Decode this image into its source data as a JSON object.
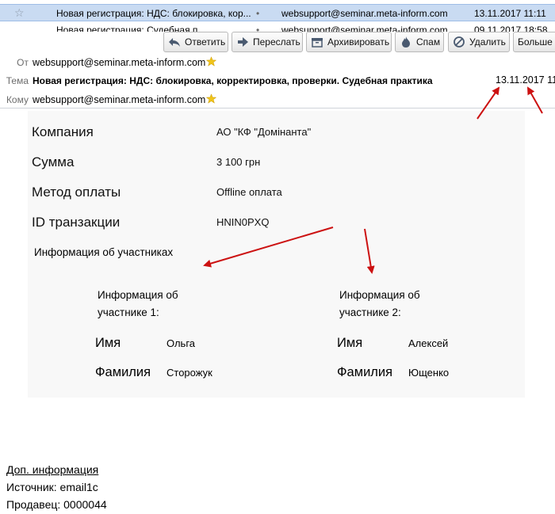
{
  "message_list": {
    "selected": {
      "subject": "Новая регистрация: НДС: блокировка, кор...",
      "from": "websupport@seminar.meta-inform.com",
      "date": "13.11.2017 11:11"
    },
    "next": {
      "subject": "Новая регистрация: Судебная п...",
      "from": "websupport@seminar.meta-inform.com",
      "date": "09.11.2017 18:58"
    }
  },
  "toolbar": {
    "reply": "Ответить",
    "forward": "Переслать",
    "archive": "Архивировать",
    "spam": "Спам",
    "delete": "Удалить",
    "more": "Больше"
  },
  "header": {
    "from_label": "От",
    "from_value": "websupport@seminar.meta-inform.com",
    "subject_label": "Тема",
    "subject_value": "Новая регистрация: НДС: блокировка, корректировка, проверки. Судебная практика",
    "date_value": "13.11.2017 11:",
    "to_label": "Кому",
    "to_value": "websupport@seminar.meta-inform.com"
  },
  "body": {
    "company_label": "Компания",
    "company_value": "АО \"КФ \"Домінанта\"",
    "amount_label": "Сумма",
    "amount_value": "3 100 грн",
    "payment_label": "Метод оплаты",
    "payment_value": "Offline оплата",
    "txn_label": "ID транзакции",
    "txn_value": "HNIN0PXQ",
    "participants_title": "Информация об участниках",
    "participants": [
      {
        "title": "Информация об участнике 1:",
        "name_label": "Имя",
        "name_value": "Ольга",
        "surname_label": "Фамилия",
        "surname_value": "Сторожук"
      },
      {
        "title": "Информация об участнике 2:",
        "name_label": "Имя",
        "name_value": "Алексей",
        "surname_label": "Фамилия",
        "surname_value": "Ющенко"
      }
    ]
  },
  "extra": {
    "title": "Доп. информация",
    "source": "Источник: email1c",
    "seller": "Продавец: 0000044"
  },
  "colors": {
    "selected_row": "#c9dbf2",
    "annotation_arrow": "#cc1111",
    "star_gold": "#f0c419"
  }
}
